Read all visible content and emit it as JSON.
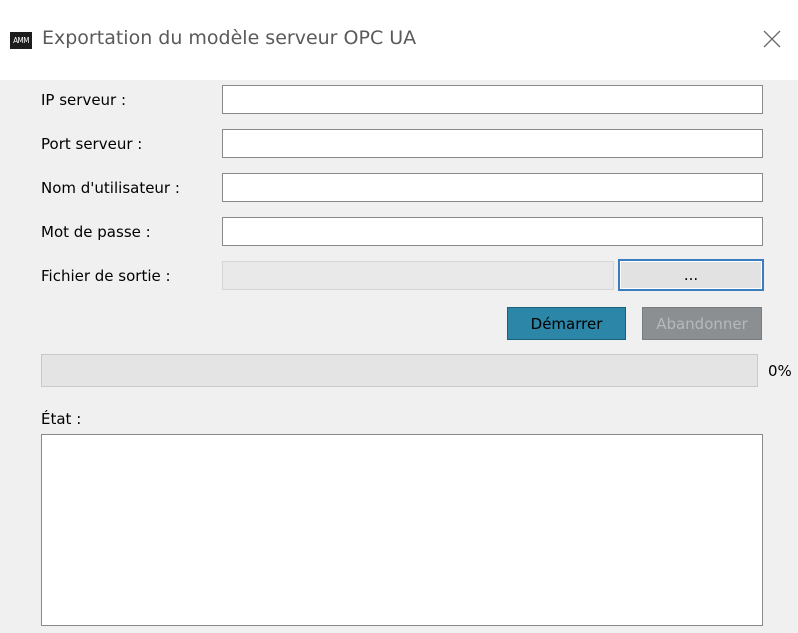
{
  "window": {
    "title": "Exportation du modèle serveur OPC UA",
    "icon_text": "AMM",
    "close_icon": "close-icon"
  },
  "form": {
    "ip_label": "IP serveur :",
    "ip_value": "",
    "port_label": "Port serveur :",
    "port_value": "",
    "user_label": "Nom d'utilisateur :",
    "user_value": "",
    "password_label": "Mot de passe :",
    "password_value": "",
    "output_label": "Fichier de sortie :",
    "output_value": "",
    "browse_label": "..."
  },
  "actions": {
    "start_label": "Démarrer",
    "abort_label": "Abandonner"
  },
  "progress": {
    "value": 0,
    "text": "0%"
  },
  "status": {
    "label": "État :",
    "text": ""
  },
  "colors": {
    "accent": "#2c86a8",
    "focus_border": "#3b7bbf"
  }
}
